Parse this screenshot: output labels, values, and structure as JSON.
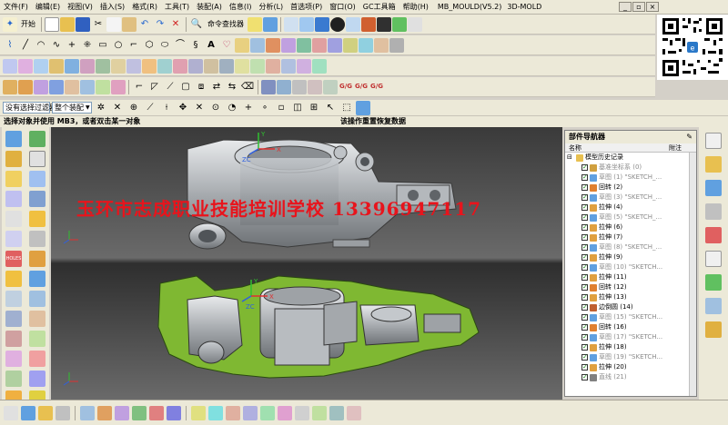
{
  "menu": {
    "items": [
      "文件(F)",
      "编辑(E)",
      "视图(V)",
      "插入(S)",
      "格式(R)",
      "工具(T)",
      "装配(A)",
      "信息(I)",
      "分析(L)",
      "首选项(P)",
      "窗口(O)",
      "GC工具箱",
      "帮助(H)"
    ],
    "version": "MB_MOULD(V5.2)",
    "suffix": "3D-MOLD"
  },
  "toolbar": {
    "start_label": "开始",
    "command_finder_label": "命令查找器"
  },
  "filterbar": {
    "selection_filter": "没有选择过滤器",
    "assembly_scope": "整个装配"
  },
  "cue": {
    "prompt": "选择对象并使用 MB3，或者双击某一对象",
    "status": "该操作重置恢复数据"
  },
  "watermark": {
    "text": "玉环市志成职业技能培训学校 13396947117"
  },
  "viewport": {
    "axis_top": {
      "x": "X",
      "y": "Y",
      "z": "ZC"
    },
    "axis_bottom": {
      "x": "X",
      "y": "Y",
      "z": "ZC"
    }
  },
  "navigator": {
    "title": "部件导航器",
    "col_name": "名称",
    "col_note": "附注",
    "root_label": "模型历史记录",
    "items": [
      {
        "label": "基准坐标系 (0)",
        "icon": "datum-csys-icon",
        "grey": true
      },
      {
        "label": "草图 (1) \"SKETCH_...",
        "icon": "sketch-icon",
        "grey": true
      },
      {
        "label": "回转 (2)",
        "icon": "revolve-icon",
        "grey": false
      },
      {
        "label": "草图 (3) \"SKETCH_...",
        "icon": "sketch-icon",
        "grey": true
      },
      {
        "label": "拉伸 (4)",
        "icon": "extrude-icon",
        "grey": false
      },
      {
        "label": "草图 (5) \"SKETCH_...",
        "icon": "sketch-icon",
        "grey": true
      },
      {
        "label": "拉伸 (6)",
        "icon": "extrude-icon",
        "grey": false
      },
      {
        "label": "拉伸 (7)",
        "icon": "extrude-icon",
        "grey": false
      },
      {
        "label": "草图 (8) \"SKETCH_...",
        "icon": "sketch-icon",
        "grey": true
      },
      {
        "label": "拉伸 (9)",
        "icon": "extrude-icon",
        "grey": false
      },
      {
        "label": "草图 (10) \"SKETCH...",
        "icon": "sketch-icon",
        "grey": true
      },
      {
        "label": "拉伸 (11)",
        "icon": "extrude-icon",
        "grey": false
      },
      {
        "label": "回转 (12)",
        "icon": "revolve-icon",
        "grey": false
      },
      {
        "label": "拉伸 (13)",
        "icon": "extrude-icon",
        "grey": false
      },
      {
        "label": "边倒圆 (14)",
        "icon": "edge-blend-icon",
        "grey": false
      },
      {
        "label": "草图 (15) \"SKETCH...",
        "icon": "sketch-icon",
        "grey": true
      },
      {
        "label": "回转 (16)",
        "icon": "revolve-icon",
        "grey": false
      },
      {
        "label": "草图 (17) \"SKETCH...",
        "icon": "sketch-icon",
        "grey": true
      },
      {
        "label": "拉伸 (18)",
        "icon": "extrude-icon",
        "grey": false
      },
      {
        "label": "草图 (19) \"SKETCH...",
        "icon": "sketch-icon",
        "grey": true
      },
      {
        "label": "拉伸 (20)",
        "icon": "extrude-icon",
        "grey": false
      },
      {
        "label": "直线 (21)",
        "icon": "line-icon",
        "grey": true
      }
    ]
  },
  "colors": {
    "watermark": "#e8141c",
    "part_section": "#7fb832",
    "part_body": "#b8bcc0",
    "ui_face": "#ece9d8",
    "viewport_bg": "#4e4e4e"
  }
}
